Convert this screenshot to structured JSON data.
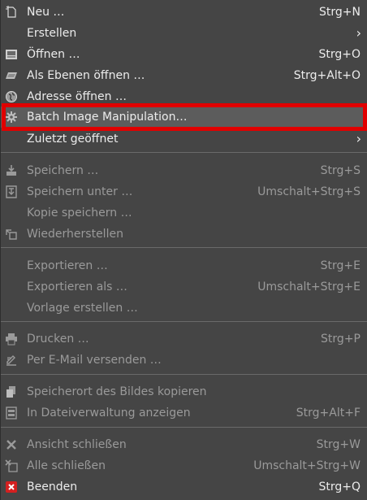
{
  "menu": {
    "items": [
      {
        "label": "Neu …",
        "shortcut": "Strg+N",
        "icon": "new-file-icon",
        "enabled": true
      },
      {
        "label": "Erstellen",
        "shortcut": "",
        "icon": "",
        "enabled": true,
        "submenu": true
      },
      {
        "label": "Öffnen …",
        "shortcut": "Strg+O",
        "icon": "open-icon",
        "enabled": true
      },
      {
        "label": "Als Ebenen öffnen …",
        "shortcut": "Strg+Alt+O",
        "icon": "layers-icon",
        "enabled": true
      },
      {
        "label": "Adresse öffnen …",
        "shortcut": "",
        "icon": "globe-icon",
        "enabled": true
      },
      {
        "label": "Batch Image Manipulation…",
        "shortcut": "",
        "icon": "gear-icon",
        "enabled": true,
        "highlighted": true
      },
      {
        "label": "Zuletzt geöffnet",
        "shortcut": "",
        "icon": "",
        "enabled": true,
        "submenu": true
      },
      {
        "label": "Speichern …",
        "shortcut": "Strg+S",
        "icon": "save-icon",
        "enabled": false
      },
      {
        "label": "Speichern unter …",
        "shortcut": "Umschalt+Strg+S",
        "icon": "save-as-icon",
        "enabled": false
      },
      {
        "label": "Kopie speichern …",
        "shortcut": "",
        "icon": "",
        "enabled": false
      },
      {
        "label": "Wiederherstellen",
        "shortcut": "",
        "icon": "revert-icon",
        "enabled": false
      },
      {
        "label": "Exportieren …",
        "shortcut": "Strg+E",
        "icon": "",
        "enabled": false
      },
      {
        "label": "Exportieren als …",
        "shortcut": "Umschalt+Strg+E",
        "icon": "",
        "enabled": false
      },
      {
        "label": "Vorlage erstellen …",
        "shortcut": "",
        "icon": "",
        "enabled": false
      },
      {
        "label": "Drucken …",
        "shortcut": "Strg+P",
        "icon": "print-icon",
        "enabled": false
      },
      {
        "label": "Per E-Mail versenden …",
        "shortcut": "",
        "icon": "email-icon",
        "enabled": false
      },
      {
        "label": "Speicherort des Bildes kopieren",
        "shortcut": "",
        "icon": "copy-location-icon",
        "enabled": false
      },
      {
        "label": "In Dateiverwaltung anzeigen",
        "shortcut": "Strg+Alt+F",
        "icon": "file-manager-icon",
        "enabled": false
      },
      {
        "label": "Ansicht schließen",
        "shortcut": "Strg+W",
        "icon": "close-icon",
        "enabled": false
      },
      {
        "label": "Alle schließen",
        "shortcut": "Umschalt+Strg+W",
        "icon": "close-all-icon",
        "enabled": false
      },
      {
        "label": "Beenden",
        "shortcut": "Strg+Q",
        "icon": "quit-icon",
        "enabled": true
      }
    ]
  },
  "colors": {
    "background": "#454545",
    "highlight": "#5c5c5c",
    "annotation_box": "#e00000",
    "text_enabled": "#ececec",
    "text_disabled": "#9a9a9a"
  }
}
